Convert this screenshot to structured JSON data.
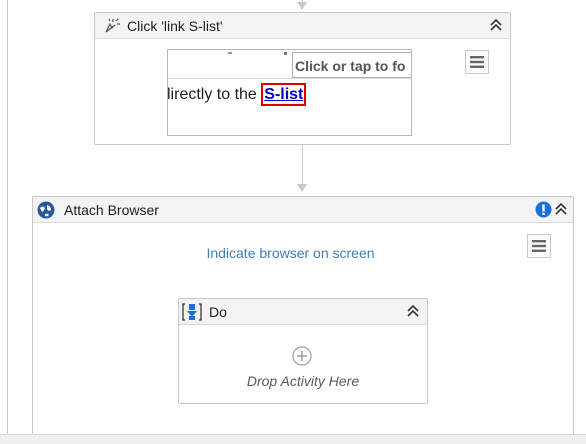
{
  "click_activity": {
    "title": "Click 'link  S-list'",
    "preview": {
      "tooltip": "Click or tap to fo",
      "text_before_link": "lirectly to the ",
      "link_text": "S-list"
    }
  },
  "attach_browser": {
    "title": "Attach Browser",
    "indicate_link": "Indicate browser on screen"
  },
  "do_sequence": {
    "title": "Do",
    "drop_hint": "Drop Activity Here"
  },
  "colors": {
    "link_blue": "#0000cc",
    "highlight_red": "#e00000",
    "indicate_blue": "#3d7fbf",
    "warning_blue": "#1e6fd9"
  }
}
